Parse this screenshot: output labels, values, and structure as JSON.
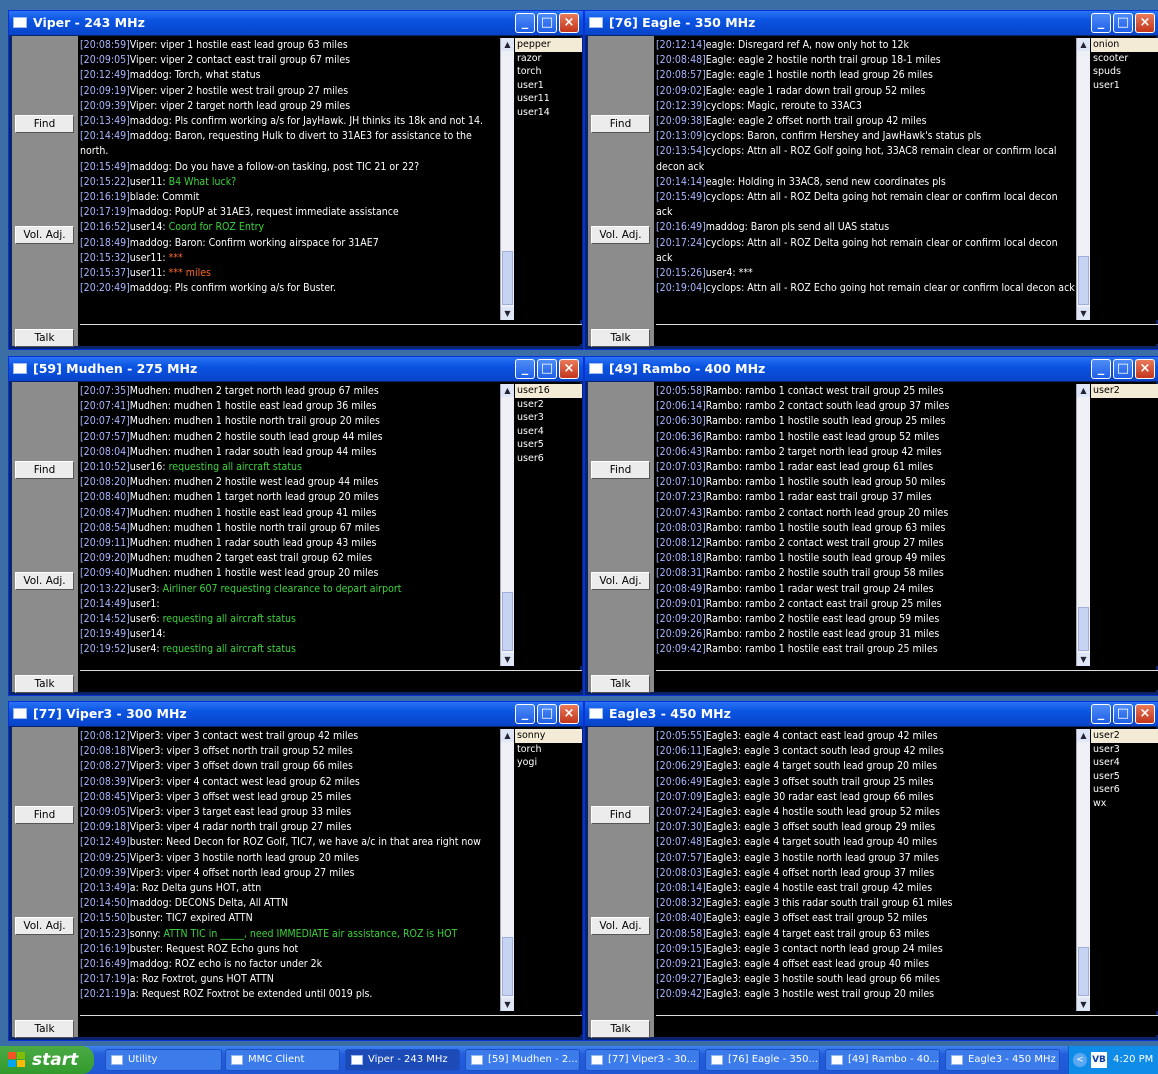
{
  "colors": {
    "green": "#3cd33c",
    "orange": "#ff6a2a",
    "timestamp": "#a9b6ff",
    "selected_user_bg": "#f3ebd5"
  },
  "icons": {
    "window": "chat-window-icon",
    "minimize": "minimize-icon",
    "maximize": "maximize-icon",
    "close": "close-icon"
  },
  "common": {
    "find": "Find",
    "vol": "Vol. Adj.",
    "talk": "Talk"
  },
  "windows": [
    {
      "title": "Viper - 243 MHz",
      "users": [
        "pepper",
        "razor",
        "torch",
        "user1",
        "user11",
        "user14"
      ],
      "selected": 0,
      "thumb": [
        0.78,
        0.22
      ],
      "lines": [
        {
          "ts": "[20:08:59]",
          "name": "Viper",
          "msg": "viper 1 hostile east lead group 63 miles",
          "c": "white"
        },
        {
          "ts": "[20:09:05]",
          "name": "Viper",
          "msg": "viper 2 contact east trail group 67 miles",
          "c": "white"
        },
        {
          "ts": "[20:12:49]",
          "name": "maddog",
          "msg": "Torch, what status",
          "c": "white"
        },
        {
          "ts": "[20:09:19]",
          "name": "Viper",
          "msg": "viper 2 hostile west trail group 27 miles",
          "c": "white"
        },
        {
          "ts": "[20:09:39]",
          "name": "Viper",
          "msg": "viper 2 target north lead group 29 miles",
          "c": "white"
        },
        {
          "ts": "[20:13:49]",
          "name": "maddog",
          "msg": "Pls confirm working a/s for JayHawk.  JH thinks its 18k and not 14.",
          "c": "white"
        },
        {
          "ts": "[20:14:49]",
          "name": "maddog",
          "msg": "Baron, requesting Hulk to divert to 31AE3 for assistance to the north.",
          "c": "white"
        },
        {
          "ts": "[20:15:49]",
          "name": "maddog",
          "msg": "Do you have a follow-on tasking, post TIC 21 or 22?",
          "c": "white"
        },
        {
          "ts": "[20:15:22]",
          "name": "user11",
          "msg": "B4  What luck?",
          "c": "green"
        },
        {
          "ts": "[20:16:19]",
          "name": "blade",
          "msg": "Commit",
          "c": "white"
        },
        {
          "ts": "[20:17:19]",
          "name": "maddog",
          "msg": "PopUP at 31AE3, request immediate assistance",
          "c": "white"
        },
        {
          "ts": "[20:16:52]",
          "name": "user14",
          "msg": "Coord for ROZ Entry",
          "c": "green"
        },
        {
          "ts": "[20:18:49]",
          "name": "maddog",
          "msg": "Baron:  Confirm working airspace for 31AE7",
          "c": "white"
        },
        {
          "ts": "[20:15:32]",
          "name": "user11",
          "msg": "***",
          "c": "orange"
        },
        {
          "ts": "[20:15:37]",
          "name": "user11",
          "msg": "*** miles",
          "c": "orange"
        },
        {
          "ts": "[20:20:49]",
          "name": "maddog",
          "msg": "Pls confirm working a/s for Buster.",
          "c": "white"
        }
      ]
    },
    {
      "title": "[76] Eagle - 350 MHz",
      "users": [
        "onion",
        "scooter",
        "spuds",
        "user1"
      ],
      "selected": 0,
      "thumb": [
        0.8,
        0.2
      ],
      "lines": [
        {
          "ts": "[20:12:14]",
          "name": "eagle",
          "msg": "Disregard ref A, now only hot to 12k",
          "c": "white"
        },
        {
          "ts": "[20:08:48]",
          "name": "Eagle",
          "msg": "eagle 2 hostile north trail group 18-1 miles",
          "c": "white"
        },
        {
          "ts": "[20:08:57]",
          "name": "Eagle",
          "msg": "eagle 1 hostile north lead group 26 miles",
          "c": "white"
        },
        {
          "ts": "[20:09:02]",
          "name": "Eagle",
          "msg": "eagle 1 radar down trail group 52 miles",
          "c": "white"
        },
        {
          "ts": "[20:12:39]",
          "name": "cyclops",
          "msg": "Magic, reroute to 33AC3",
          "c": "white"
        },
        {
          "ts": "[20:09:38]",
          "name": "Eagle",
          "msg": "eagle 2 offset north trail group 42 miles",
          "c": "white"
        },
        {
          "ts": "[20:13:09]",
          "name": "cyclops",
          "msg": "Baron, confirm Hershey and JawHawk's status pls",
          "c": "white"
        },
        {
          "ts": "[20:13:54]",
          "name": "cyclops",
          "msg": "Attn all - ROZ Golf going hot, 33AC8 remain clear or confirm local decon ack",
          "c": "white"
        },
        {
          "ts": "[20:14:14]",
          "name": "eagle",
          "msg": "Holding in 33AC8, send new coordinates pls",
          "c": "white"
        },
        {
          "ts": "[20:15:49]",
          "name": "cyclops",
          "msg": "Attn all - ROZ Delta going hot remain clear or confirm local decon ack",
          "c": "white"
        },
        {
          "ts": "[20:16:49]",
          "name": "maddog",
          "msg": "Baron pls send all UAS status",
          "c": "white"
        },
        {
          "ts": "[20:17:24]",
          "name": "cyclops",
          "msg": "Attn all - ROZ Delta going hot remain clear or confirm local decon ack",
          "c": "white"
        },
        {
          "ts": "[20:15:26]",
          "name": "user4",
          "msg": "***",
          "c": "white"
        },
        {
          "ts": "[20:19:04]",
          "name": "cyclops",
          "msg": "Attn all - ROZ Echo going hot remain clear or confirm local decon ack",
          "c": "white"
        }
      ]
    },
    {
      "title": "[59] Mudhen - 275 MHz",
      "users": [
        "user16",
        "user2",
        "user3",
        "user4",
        "user5",
        "user6"
      ],
      "selected": 0,
      "thumb": [
        0.76,
        0.24
      ],
      "lines": [
        {
          "ts": "[20:07:35]",
          "name": "Mudhen",
          "msg": "mudhen 2 target north lead group 67 miles",
          "c": "white"
        },
        {
          "ts": "[20:07:41]",
          "name": "Mudhen",
          "msg": "mudhen 1 hostile east lead group 36 miles",
          "c": "white"
        },
        {
          "ts": "[20:07:47]",
          "name": "Mudhen",
          "msg": "mudhen 1 hostile north trail group 20 miles",
          "c": "white"
        },
        {
          "ts": "[20:07:57]",
          "name": "Mudhen",
          "msg": "mudhen 2 hostile south lead group 44 miles",
          "c": "white"
        },
        {
          "ts": "[20:08:04]",
          "name": "Mudhen",
          "msg": "mudhen 1 radar south lead group 44 miles",
          "c": "white"
        },
        {
          "ts": "[20:10:52]",
          "name": "user16",
          "msg": "requesting all aircraft status",
          "c": "green"
        },
        {
          "ts": "[20:08:20]",
          "name": "Mudhen",
          "msg": "mudhen 2 hostile west lead group 44 miles",
          "c": "white"
        },
        {
          "ts": "[20:08:40]",
          "name": "Mudhen",
          "msg": "mudhen 1 target north lead group 20 miles",
          "c": "white"
        },
        {
          "ts": "[20:08:47]",
          "name": "Mudhen",
          "msg": "mudhen 1 hostile east lead group 41 miles",
          "c": "white"
        },
        {
          "ts": "[20:08:54]",
          "name": "Mudhen",
          "msg": "mudhen 1 hostile north trail group 67 miles",
          "c": "white"
        },
        {
          "ts": "[20:09:11]",
          "name": "Mudhen",
          "msg": "mudhen 1 radar south lead group 43 miles",
          "c": "white"
        },
        {
          "ts": "[20:09:20]",
          "name": "Mudhen",
          "msg": "mudhen 2 target east trail group 62 miles",
          "c": "white"
        },
        {
          "ts": "[20:09:40]",
          "name": "Mudhen",
          "msg": "mudhen 1 hostile west lead group 20 miles",
          "c": "white"
        },
        {
          "ts": "[20:13:22]",
          "name": "user3",
          "msg": "Airliner 607 requesting clearance to depart airport",
          "c": "green"
        },
        {
          "ts": "[20:14:49]",
          "name": "user1",
          "msg": "",
          "c": "white"
        },
        {
          "ts": "[20:14:52]",
          "name": "user6",
          "msg": "requesting all aircraft status",
          "c": "green"
        },
        {
          "ts": "[20:19:49]",
          "name": "user14",
          "msg": "",
          "c": "white"
        },
        {
          "ts": "[20:19:52]",
          "name": "user4",
          "msg": "requesting all aircraft status",
          "c": "green"
        }
      ]
    },
    {
      "title": "[49] Rambo - 400 MHz",
      "users": [
        "user2"
      ],
      "selected": 0,
      "thumb": [
        0.82,
        0.18
      ],
      "lines": [
        {
          "ts": "[20:05:58]",
          "name": "Rambo",
          "msg": "rambo 1 contact west trail group 25 miles",
          "c": "white"
        },
        {
          "ts": "[20:06:14]",
          "name": "Rambo",
          "msg": "rambo 2 contact south lead group 37 miles",
          "c": "white"
        },
        {
          "ts": "[20:06:30]",
          "name": "Rambo",
          "msg": "rambo 1 hostile south lead group 25 miles",
          "c": "white"
        },
        {
          "ts": "[20:06:36]",
          "name": "Rambo",
          "msg": "rambo 1 hostile east lead group 52 miles",
          "c": "white"
        },
        {
          "ts": "[20:06:43]",
          "name": "Rambo",
          "msg": "rambo 2 target north lead group 42 miles",
          "c": "white"
        },
        {
          "ts": "[20:07:03]",
          "name": "Rambo",
          "msg": "rambo 1 radar east lead group 61 miles",
          "c": "white"
        },
        {
          "ts": "[20:07:10]",
          "name": "Rambo",
          "msg": "rambo 1 hostile south lead group 50 miles",
          "c": "white"
        },
        {
          "ts": "[20:07:23]",
          "name": "Rambo",
          "msg": "rambo 1 radar east trail group 37 miles",
          "c": "white"
        },
        {
          "ts": "[20:07:43]",
          "name": "Rambo",
          "msg": "rambo 2 contact north lead group 20 miles",
          "c": "white"
        },
        {
          "ts": "[20:08:03]",
          "name": "Rambo",
          "msg": "rambo 1 hostile south lead group 63 miles",
          "c": "white"
        },
        {
          "ts": "[20:08:12]",
          "name": "Rambo",
          "msg": "rambo 2 contact west trail group 27 miles",
          "c": "white"
        },
        {
          "ts": "[20:08:18]",
          "name": "Rambo",
          "msg": "rambo 1 hostile south lead group 49 miles",
          "c": "white"
        },
        {
          "ts": "[20:08:31]",
          "name": "Rambo",
          "msg": "rambo 2 hostile south trail group 58 miles",
          "c": "white"
        },
        {
          "ts": "[20:08:49]",
          "name": "Rambo",
          "msg": "rambo 1 radar west trail group 24 miles",
          "c": "white"
        },
        {
          "ts": "[20:09:01]",
          "name": "Rambo",
          "msg": "rambo 2 contact east trail group 25 miles",
          "c": "white"
        },
        {
          "ts": "[20:09:20]",
          "name": "Rambo",
          "msg": "rambo 2 hostile east lead group 59 miles",
          "c": "white"
        },
        {
          "ts": "[20:09:26]",
          "name": "Rambo",
          "msg": "rambo 2 hostile east lead group 31 miles",
          "c": "white"
        },
        {
          "ts": "[20:09:42]",
          "name": "Rambo",
          "msg": "rambo 1 hostile east trail group 25 miles",
          "c": "white"
        }
      ]
    },
    {
      "title": "[77] Viper3 - 300 MHz",
      "users": [
        "sonny",
        "torch",
        "yogi"
      ],
      "selected": 0,
      "thumb": [
        0.76,
        0.24
      ],
      "lines": [
        {
          "ts": "[20:08:12]",
          "name": "Viper3",
          "msg": "viper 3 contact west trail group 42 miles",
          "c": "white"
        },
        {
          "ts": "[20:08:18]",
          "name": "Viper3",
          "msg": "viper 3 offset north trail group 52 miles",
          "c": "white"
        },
        {
          "ts": "[20:08:27]",
          "name": "Viper3",
          "msg": "viper 3 offset down trail group 66 miles",
          "c": "white"
        },
        {
          "ts": "[20:08:39]",
          "name": "Viper3",
          "msg": "viper 4 contact west lead group 62 miles",
          "c": "white"
        },
        {
          "ts": "[20:08:45]",
          "name": "Viper3",
          "msg": "viper 3 offset west lead group 25 miles",
          "c": "white"
        },
        {
          "ts": "[20:09:05]",
          "name": "Viper3",
          "msg": "viper 3 target east lead group 33 miles",
          "c": "white"
        },
        {
          "ts": "[20:09:18]",
          "name": "Viper3",
          "msg": "viper 4 radar north trail group 27 miles",
          "c": "white"
        },
        {
          "ts": "[20:12:49]",
          "name": "buster",
          "msg": "Need Decon for ROZ Golf,  TIC7, we have a/c in that area right now",
          "c": "white"
        },
        {
          "ts": "[20:09:25]",
          "name": "Viper3",
          "msg": "viper 3 hostile north lead group 20 miles",
          "c": "white"
        },
        {
          "ts": "[20:09:39]",
          "name": "Viper3",
          "msg": "viper 4 offset north lead group 27 miles",
          "c": "white"
        },
        {
          "ts": "[20:13:49]",
          "name": "a",
          "msg": "Roz Delta guns  HOT, attn",
          "c": "white"
        },
        {
          "ts": "[20:14:50]",
          "name": "maddog",
          "msg": "DECONS Delta, All ATTN",
          "c": "white"
        },
        {
          "ts": "[20:15:50]",
          "name": "buster",
          "msg": "TIC7 expired ATTN",
          "c": "white"
        },
        {
          "ts": "[20:15:23]",
          "name": "sonny",
          "msg": "ATTN  TIC  in _____, need IMMEDIATE air assistance,  ROZ is HOT",
          "c": "green"
        },
        {
          "ts": "[20:16:19]",
          "name": "buster",
          "msg": "Request ROZ Echo guns hot",
          "c": "white"
        },
        {
          "ts": "[20:16:49]",
          "name": "maddog",
          "msg": "ROZ echo is no factor under 2k",
          "c": "white"
        },
        {
          "ts": "[20:17:19]",
          "name": "a",
          "msg": "Roz Foxtrot, guns HOT ATTN",
          "c": "white"
        },
        {
          "ts": "[20:21:19]",
          "name": "a",
          "msg": "Request ROZ Foxtrot be extended until 0019 pls.",
          "c": "white"
        }
      ]
    },
    {
      "title": "Eagle3 - 450 MHz",
      "users": [
        "user2",
        "user3",
        "user4",
        "user5",
        "user6",
        "wx"
      ],
      "selected": 0,
      "thumb": [
        0.8,
        0.2
      ],
      "lines": [
        {
          "ts": "[20:05:55]",
          "name": "Eagle3",
          "msg": "eagle 4 contact east lead group 42 miles",
          "c": "white"
        },
        {
          "ts": "[20:06:11]",
          "name": "Eagle3",
          "msg": "eagle 3 contact south lead group 42 miles",
          "c": "white"
        },
        {
          "ts": "[20:06:29]",
          "name": "Eagle3",
          "msg": "eagle 4 target south lead group 20 miles",
          "c": "white"
        },
        {
          "ts": "[20:06:49]",
          "name": "Eagle3",
          "msg": "eagle 3 offset south trail group 25 miles",
          "c": "white"
        },
        {
          "ts": "[20:07:09]",
          "name": "Eagle3",
          "msg": "eagle 30 radar east lead group 66 miles",
          "c": "white"
        },
        {
          "ts": "[20:07:24]",
          "name": "Eagle3",
          "msg": "eagle 4 hostile south lead group 52 miles",
          "c": "white"
        },
        {
          "ts": "[20:07:30]",
          "name": "Eagle3",
          "msg": "eagle 3 offset south lead group 29 miles",
          "c": "white"
        },
        {
          "ts": "[20:07:48]",
          "name": "Eagle3",
          "msg": "eagle 4 target south lead group 40 miles",
          "c": "white"
        },
        {
          "ts": "[20:07:57]",
          "name": "Eagle3",
          "msg": "eagle 3 hostile north lead group 37 miles",
          "c": "white"
        },
        {
          "ts": "[20:08:03]",
          "name": "Eagle3",
          "msg": "eagle 4 offset north lead group 37 miles",
          "c": "white"
        },
        {
          "ts": "[20:08:14]",
          "name": "Eagle3",
          "msg": "eagle 4 hostile east trail group 42 miles",
          "c": "white"
        },
        {
          "ts": "[20:08:32]",
          "name": "Eagle3",
          "msg": "eagle 3 this radar south trail group 61 miles",
          "c": "white"
        },
        {
          "ts": "[20:08:40]",
          "name": "Eagle3",
          "msg": "eagle 3 offset east trail group 52 miles",
          "c": "white"
        },
        {
          "ts": "[20:08:58]",
          "name": "Eagle3",
          "msg": "eagle 4 target east trail group 63 miles",
          "c": "white"
        },
        {
          "ts": "[20:09:15]",
          "name": "Eagle3",
          "msg": "eagle 3 contact north lead group 24 miles",
          "c": "white"
        },
        {
          "ts": "[20:09:21]",
          "name": "Eagle3",
          "msg": "eagle 4 offset east lead group 40 miles",
          "c": "white"
        },
        {
          "ts": "[20:09:27]",
          "name": "Eagle3",
          "msg": "eagle 3 hostile south lead group 66 miles",
          "c": "white"
        },
        {
          "ts": "[20:09:42]",
          "name": "Eagle3",
          "msg": "eagle 3 hostile west trail group 20 miles",
          "c": "white"
        }
      ]
    }
  ],
  "taskbar": {
    "start": "start",
    "start_icon": "windows-logo-icon",
    "items": [
      {
        "label": "Utility",
        "icon": "folder-icon",
        "active": false
      },
      {
        "label": "MMC Client",
        "icon": "window-icon",
        "active": false
      },
      {
        "label": "Viper - 243 MHz",
        "icon": "window-icon",
        "active": true
      },
      {
        "label": "[59] Mudhen - 2...",
        "icon": "window-icon",
        "active": false
      },
      {
        "label": "[77] Viper3 - 30...",
        "icon": "window-icon",
        "active": false
      },
      {
        "label": "[76] Eagle - 350...",
        "icon": "window-icon",
        "active": false
      },
      {
        "label": "[49] Rambo - 40...",
        "icon": "window-icon",
        "active": false
      },
      {
        "label": "Eagle3 - 450 MHz",
        "icon": "window-icon",
        "active": false
      }
    ],
    "tray_chevron": "<",
    "tray_icon": "VB",
    "clock": "4:20 PM"
  }
}
